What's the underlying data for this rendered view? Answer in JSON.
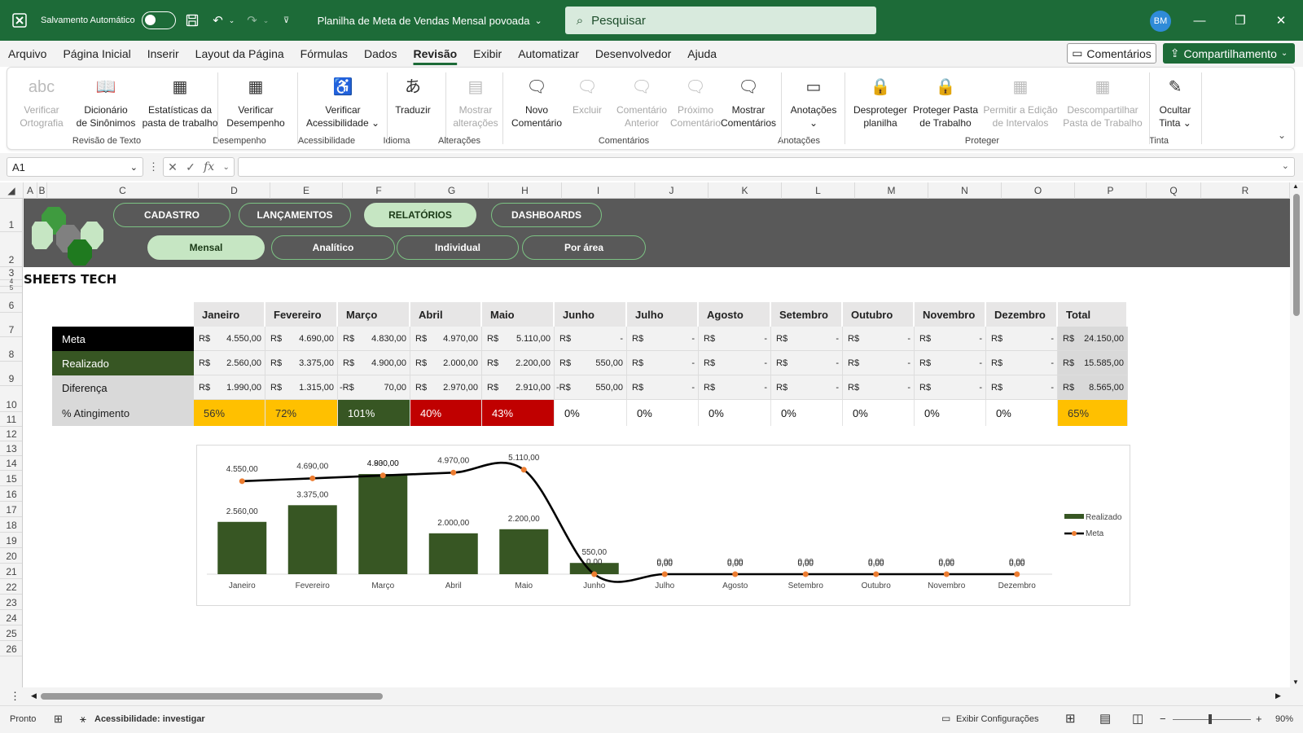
{
  "titlebar": {
    "autosave_label": "Salvamento Automático",
    "doc_title": "Planilha de Meta de Vendas Mensal povoada",
    "search_placeholder": "Pesquisar",
    "avatar_initials": "BM"
  },
  "menu": {
    "items": [
      "Arquivo",
      "Página Inicial",
      "Inserir",
      "Layout da Página",
      "Fórmulas",
      "Dados",
      "Revisão",
      "Exibir",
      "Automatizar",
      "Desenvolvedor",
      "Ajuda"
    ],
    "active": "Revisão",
    "comments_label": "Comentários",
    "share_label": "Compartilhamento"
  },
  "ribbon": {
    "buttons": [
      {
        "line1": "Verificar",
        "line2": "Ortografia",
        "disabled": true
      },
      {
        "line1": "Dicionário",
        "line2": "de Sinônimos",
        "disabled": false
      },
      {
        "line1": "Estatísticas da",
        "line2": "pasta de trabalho",
        "disabled": false
      },
      {
        "line1": "Verificar",
        "line2": "Desempenho",
        "disabled": false
      },
      {
        "line1": "Verificar",
        "line2": "Acessibilidade ⌄",
        "disabled": false
      },
      {
        "line1": "Traduzir",
        "line2": "",
        "disabled": false
      },
      {
        "line1": "Mostrar",
        "line2": "alterações",
        "disabled": true
      },
      {
        "line1": "Novo",
        "line2": "Comentário",
        "disabled": false
      },
      {
        "line1": "Excluir",
        "line2": "",
        "disabled": true
      },
      {
        "line1": "Comentário",
        "line2": "Anterior",
        "disabled": true
      },
      {
        "line1": "Próximo",
        "line2": "Comentário",
        "disabled": true
      },
      {
        "line1": "Mostrar",
        "line2": "Comentários",
        "disabled": false
      },
      {
        "line1": "Anotações",
        "line2": "⌄",
        "disabled": false
      },
      {
        "line1": "Desproteger",
        "line2": "planilha",
        "disabled": false
      },
      {
        "line1": "Proteger Pasta",
        "line2": "de Trabalho",
        "disabled": false
      },
      {
        "line1": "Permitir a Edição",
        "line2": "de Intervalos",
        "disabled": true
      },
      {
        "line1": "Descompartilhar",
        "line2": "Pasta de Trabalho",
        "disabled": true
      },
      {
        "line1": "Ocultar",
        "line2": "Tinta ⌄",
        "disabled": false
      }
    ],
    "groups": [
      "Revisão de Texto",
      "Desempenho",
      "Acessibilidade",
      "Idioma",
      "Alterações",
      "Comentários",
      "Anotações",
      "Proteger",
      "Tinta"
    ]
  },
  "formula_bar": {
    "name_box": "A1",
    "fx": "fx"
  },
  "columns": [
    "A",
    "B",
    "C",
    "D",
    "E",
    "F",
    "G",
    "H",
    "I",
    "J",
    "K",
    "L",
    "M",
    "N",
    "O",
    "P",
    "Q",
    "R"
  ],
  "rows": [
    "1",
    "2",
    "3",
    "4",
    "5",
    "6",
    "7",
    "8",
    "9",
    "10",
    "11",
    "12",
    "13",
    "14",
    "15",
    "16",
    "17",
    "18",
    "19",
    "20",
    "21",
    "22",
    "23",
    "24",
    "25",
    "26"
  ],
  "nav": {
    "top": [
      "CADASTRO",
      "LANÇAMENTOS",
      "RELATÓRIOS",
      "DASHBOARDS"
    ],
    "top_active": 2,
    "sub": [
      "Mensal",
      "Analítico",
      "Individual",
      "Por área"
    ],
    "sub_active": 0
  },
  "brand": "SHEETS TECH",
  "table": {
    "months": [
      "Janeiro",
      "Fevereiro",
      "Março",
      "Abril",
      "Maio",
      "Junho",
      "Julho",
      "Agosto",
      "Setembro",
      "Outubro",
      "Novembro",
      "Dezembro",
      "Total"
    ],
    "currency": "R$",
    "rows": [
      {
        "label": "Meta",
        "values": [
          "4.550,00",
          "4.690,00",
          "4.830,00",
          "4.970,00",
          "5.110,00",
          "-",
          "-",
          "-",
          "-",
          "-",
          "-",
          "-",
          "24.150,00"
        ]
      },
      {
        "label": "Realizado",
        "values": [
          "2.560,00",
          "3.375,00",
          "4.900,00",
          "2.000,00",
          "2.200,00",
          "550,00",
          "-",
          "-",
          "-",
          "-",
          "-",
          "-",
          "15.585,00"
        ]
      },
      {
        "label": "Diferença",
        "values": [
          "1.990,00",
          "1.315,00",
          "70,00",
          "2.970,00",
          "2.910,00",
          "550,00",
          "-",
          "-",
          "-",
          "-",
          "-",
          "-",
          "8.565,00"
        ],
        "negative": [
          false,
          false,
          true,
          false,
          false,
          true,
          false,
          false,
          false,
          false,
          false,
          false,
          false
        ]
      }
    ],
    "pct_label": "% Atingimento",
    "pct": [
      "56%",
      "72%",
      "101%",
      "40%",
      "43%",
      "0%",
      "0%",
      "0%",
      "0%",
      "0%",
      "0%",
      "0%",
      "65%"
    ],
    "colors": {
      "meta": "#000000",
      "realizado": "#375623",
      "diferenca": "#d9d9d9",
      "yellow": "#ffc000",
      "green": "#375623",
      "red": "#c00000"
    }
  },
  "chart_data": {
    "type": "bar",
    "categories": [
      "Janeiro",
      "Fevereiro",
      "Março",
      "Abril",
      "Maio",
      "Junho",
      "Julho",
      "Agosto",
      "Setembro",
      "Outubro",
      "Novembro",
      "Dezembro"
    ],
    "series": [
      {
        "name": "Realizado",
        "type": "bar",
        "color": "#375623",
        "values": [
          2560,
          3375,
          4900,
          2000,
          2200,
          550,
          0,
          0,
          0,
          0,
          0,
          0
        ],
        "labels": [
          "2.560,00",
          "3.375,00",
          "4.900,00",
          "2.000,00",
          "2.200,00",
          "550,00",
          "0,00",
          "0,00",
          "0,00",
          "0,00",
          "0,00",
          "0,00"
        ]
      },
      {
        "name": "Meta",
        "type": "line",
        "color": "#000000",
        "marker_color": "#ed7d31",
        "values": [
          4550,
          4690,
          4830,
          4970,
          5110,
          0,
          0,
          0,
          0,
          0,
          0,
          0
        ],
        "labels": [
          "4.550,00",
          "4.690,00",
          "4.830,00",
          "4.970,00",
          "5.110,00",
          "0,00",
          "0,00",
          "0,00",
          "0,00",
          "0,00",
          "0,00",
          "0,00"
        ]
      }
    ],
    "ylim": [
      0,
      5500
    ],
    "legend": "right",
    "grid": false
  },
  "status": {
    "ready": "Pronto",
    "accessibility": "Acessibilidade: investigar",
    "display_settings": "Exibir Configurações",
    "zoom": "90%"
  }
}
